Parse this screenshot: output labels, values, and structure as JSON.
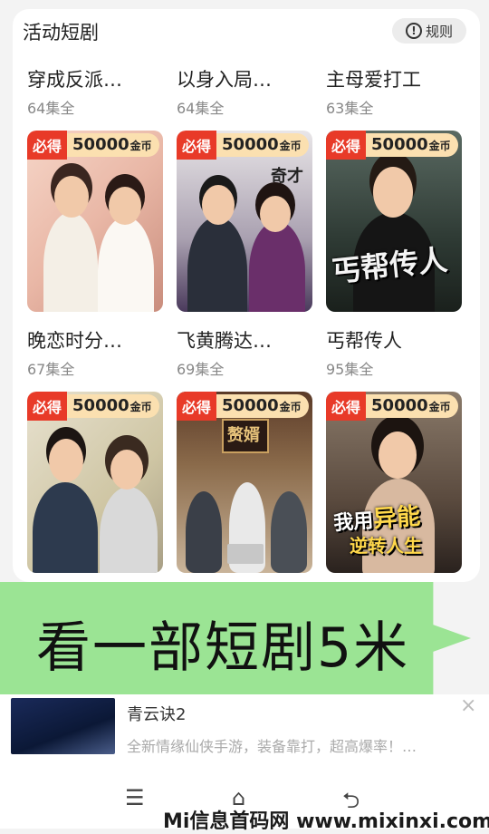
{
  "header": {
    "title": "活动短剧",
    "rules_label": "规则",
    "rules_icon": "!"
  },
  "reward": {
    "must_label": "必得",
    "amount": "50000",
    "unit": "金币"
  },
  "dramas": [
    {
      "title": "穿成反派…",
      "episodes": "64集全"
    },
    {
      "title": "以身入局…",
      "episodes": "64集全"
    },
    {
      "title": "主母爱打工",
      "episodes": "63集全"
    },
    {
      "title": "晚恋时分…",
      "episodes": "67集全",
      "poster_text": ""
    },
    {
      "title": "飞黄腾达…",
      "episodes": "69集全"
    },
    {
      "title": "丐帮传人",
      "episodes": "95集全"
    }
  ],
  "posters": {
    "p2_text": "奇才",
    "p3_text": "丐帮传人",
    "p5_text": "赘婿",
    "p6_line1_a": "我用",
    "p6_line1_b": "异能",
    "p6_line2": "逆转人生"
  },
  "banner": {
    "text": "看一部短剧5米"
  },
  "ad": {
    "title": "青云诀2",
    "description": "全新情缘仙侠手游，装备靠打，超高爆率！…",
    "close": "×"
  },
  "nav": {
    "menu": "☰",
    "home": "⌂",
    "back": "⮌"
  },
  "watermark": {
    "text": "Mi信息首码网 www.mixinxi.com"
  }
}
